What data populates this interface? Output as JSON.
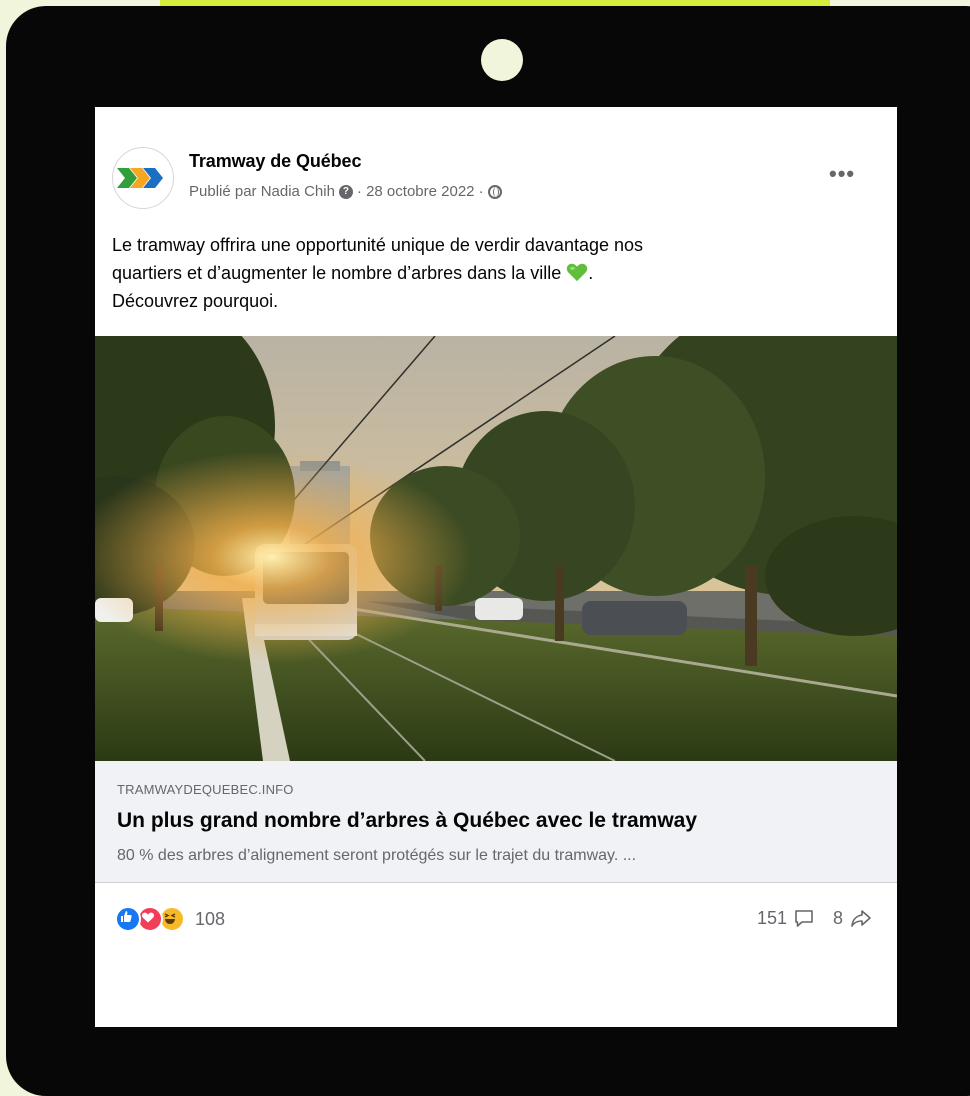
{
  "post": {
    "page_name": "Tramway de Québec",
    "published_by": "Publié par Nadia Chih",
    "date": "· 28 octobre 2022 ·",
    "more_icon": "more-options-icon",
    "text_line1": "Le tramway offrira une opportunité unique de verdir davantage nos",
    "text_line2": "quartiers et d’augmenter le nombre d’arbres dans la ville",
    "text_line2_suffix": ".",
    "text_line3": "Découvrez pourquoi."
  },
  "link": {
    "domain": "TRAMWAYDEQUEBEC.INFO",
    "title": "Un plus grand nombre d’arbres à Québec avec le tramway",
    "description": "80 % des arbres d’alignement seront protégés sur le trajet du tramway. ..."
  },
  "stats": {
    "reactions_count": "108",
    "comments_count": "151",
    "shares_count": "8"
  },
  "colors": {
    "background": "#f1f5dc",
    "accent_band": "#d7ec3c",
    "device": "#070707",
    "like": "#1877f2",
    "love": "#f33e58",
    "haha": "#f7b928",
    "green_heart": "#5fbf3c"
  }
}
